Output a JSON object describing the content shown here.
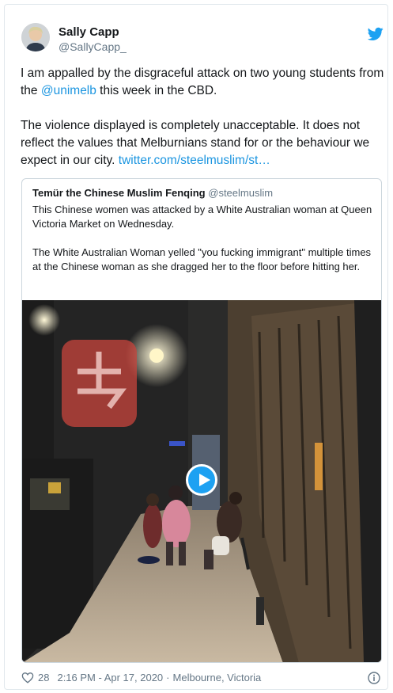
{
  "tweet": {
    "author_name": "Sally Capp",
    "author_handle": "@SallyCapp_",
    "text_p1_before": "I am appalled by the disgraceful attack on two young students from the ",
    "text_p1_mention": "@unimelb",
    "text_p1_after": " this week in the CBD.",
    "text_p2_before": "The violence displayed is completely unacceptable. It does not reflect the values that Melburnians stand for or the behaviour we expect in our city. ",
    "text_p2_link": "twitter.com/steelmuslim/st…",
    "likes": "28",
    "timestamp": "2:16 PM - Apr 17, 2020",
    "location": "Melbourne, Victoria",
    "icons": {
      "avatar": "avatar-photo",
      "bird": "twitter-bird-icon",
      "heart": "heart-icon",
      "info": "info-icon",
      "play": "play-icon"
    },
    "colors": {
      "link": "#1b95e0",
      "brand": "#1da1f2",
      "muted": "#657786"
    }
  },
  "quote": {
    "author_name": "Temür the Chinese Muslim Fenqing",
    "author_handle": "@steelmuslim",
    "text_p1": "This Chinese women was attacked by a White Australian woman at Queen Victoria Market on Wednesday.",
    "text_p2": "The White Australian Woman yelled \"you fucking immigrant\"  multiple times at the Chinese woman as she dragged her to the floor before hitting her."
  }
}
